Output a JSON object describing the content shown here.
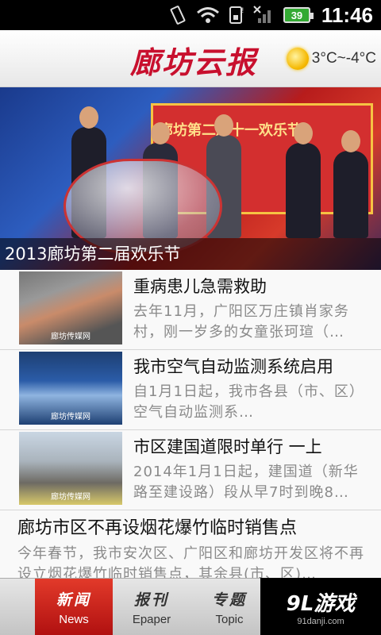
{
  "status": {
    "battery": "39",
    "time": "11:46"
  },
  "header": {
    "brand": "廊坊云报",
    "weather": "3°C~-4°C"
  },
  "hero": {
    "stage_text": "廊坊第二届十一欢乐节",
    "caption": "2013廊坊第二届欢乐节"
  },
  "news": [
    {
      "title": "重病患儿急需救助",
      "desc": "去年11月，广阳区万庄镇肖家务村，刚一岁多的女童张珂瑄（…",
      "watermark": "廊坊传媒网"
    },
    {
      "title": "我市空气自动监测系统启用",
      "desc": "自1月1日起，我市各县（市、区）空气自动监测系…",
      "watermark": "廊坊传媒网"
    },
    {
      "title": "市区建国道限时单行 一上",
      "desc": "2014年1月1日起，建国道（新华路至建设路）段从早7时到晚8…",
      "watermark": "廊坊传媒网"
    },
    {
      "title": "廊坊市区不再设烟花爆竹临时销售点",
      "desc": "今年春节，我市安次区、广阳区和廊坊开发区将不再设立烟花爆竹临时销售点，其余县(市、区)…"
    }
  ],
  "tabs": [
    {
      "zh": "新闻",
      "en": "News"
    },
    {
      "zh": "报刊",
      "en": "Epaper"
    },
    {
      "zh": "专题",
      "en": "Topic"
    }
  ],
  "badge": {
    "main": "9L游戏",
    "sub": "91danji.com"
  },
  "colors": {
    "brand_red": "#c8102e",
    "tab_active": "#c8201a"
  }
}
